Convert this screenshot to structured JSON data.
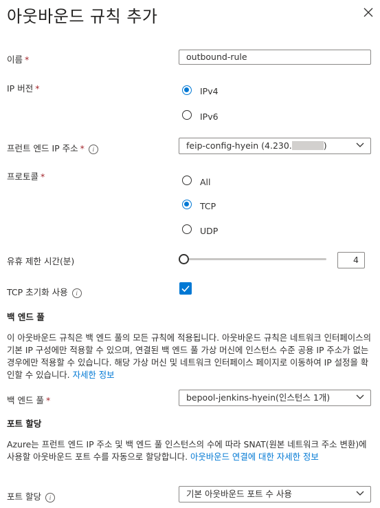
{
  "page": {
    "title": "아웃바운드 규칙 추가"
  },
  "fields": {
    "name": {
      "label": "이름",
      "required_mark": "*",
      "value": "outbound-rule"
    },
    "ip_version": {
      "label": "IP 버전",
      "required_mark": "*",
      "options": [
        "IPv4",
        "IPv6"
      ],
      "selected": "IPv4"
    },
    "frontend_ip": {
      "label": "프런트 엔드 IP 주소",
      "required_mark": "*",
      "value": "feip-config-hyein (4.230.",
      "value_suffix": ")"
    },
    "protocol": {
      "label": "프로토콜",
      "required_mark": "*",
      "options": [
        "All",
        "TCP",
        "UDP"
      ],
      "selected": "TCP"
    },
    "idle_timeout": {
      "label": "유휴 제한 시간(분)",
      "value": "4",
      "slider_fraction": 0.0
    },
    "tcp_reset": {
      "label": "TCP 초기화 사용",
      "checked": true
    }
  },
  "backend_pool_section": {
    "heading": "백 엔드 풀",
    "description": "이 아웃바운드 규칙은 백 엔드 풀의 모든 규칙에 적용됩니다. 아웃바운드 규칙은 네트워크 인터페이스의 기본 IP 구성에만 적용할 수 있으며, 연결된 백 엔드 풀 가상 머신에 인스턴스 수준 공용 IP 주소가 없는 경우에만 적용할 수 있습니다. 해당 가상 머신 및 네트워크 인터페이스 페이지로 이동하여 IP 설정을 확인할 수 있습니다.",
    "link": "자세한 정보",
    "field": {
      "label": "백 엔드 풀",
      "required_mark": "*",
      "value": "bepool-jenkins-hyein(인스턴스 1개)"
    }
  },
  "port_allocation_section": {
    "heading": "포트 할당",
    "description": "Azure는 프런트 엔드 IP 주소 및 백 엔드 풀 인스턴스의 수에 따라 SNAT(원본 네트워크 주소 변환)에 사용할 아웃바운드 포트 수를 자동으로 할당합니다.",
    "link": "아웃바운드 연결에 대한 자세한 정보",
    "field": {
      "label": "포트 할당",
      "value": "기본 아웃바운드 포트 수 사용"
    }
  },
  "colors": {
    "accent": "#0078d4",
    "required": "#a4262c",
    "border": "#8a8886",
    "text": "#323130"
  },
  "icons": {
    "close": "close-icon",
    "info": "info-icon",
    "chevron": "chevron-down-icon",
    "check": "checkmark-icon"
  }
}
